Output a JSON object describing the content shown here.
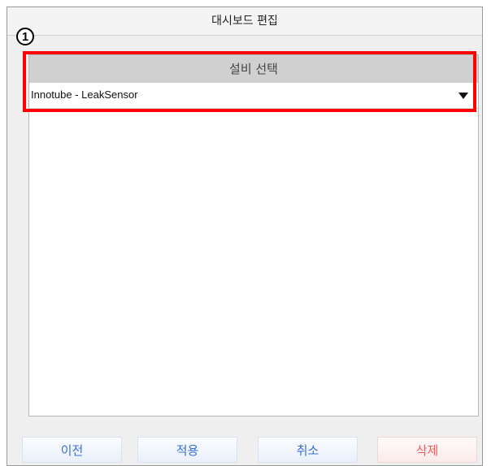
{
  "dialog": {
    "title": "대시보드 편집"
  },
  "callout": {
    "number": "1"
  },
  "equipment_select": {
    "header": "설비 선택",
    "selected_value": "Innotube - LeakSensor",
    "arrow_icon": "dropdown-triangle-icon"
  },
  "buttons": {
    "prev_label": "이전",
    "apply_label": "적용",
    "cancel_label": "취소",
    "delete_label": "삭제"
  },
  "colors": {
    "highlight": "#ff0000",
    "button_text": "#3a6fd0",
    "delete_text": "#f05a5a"
  }
}
